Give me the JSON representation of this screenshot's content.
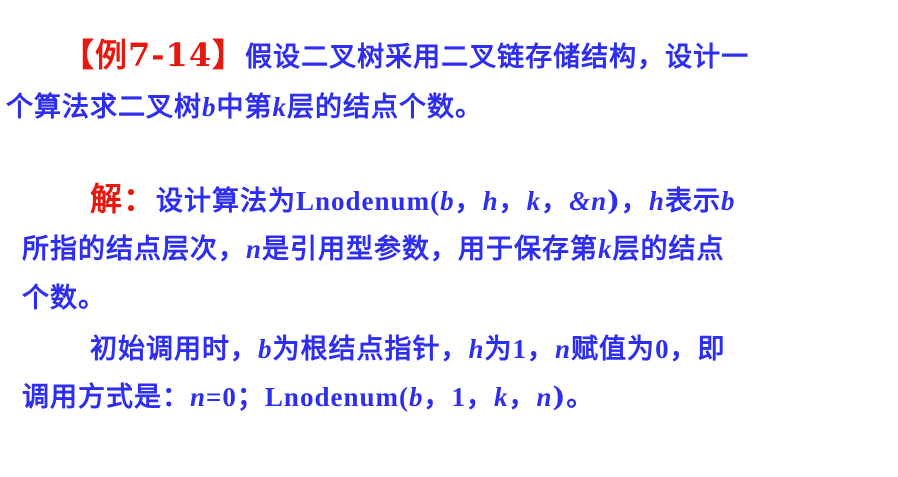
{
  "example": {
    "label": "【例7-14】",
    "line1": "假设二叉树采用二叉链存储结构，设计一",
    "line2_a": "个算法求二叉树",
    "var_b": "b",
    "line2_b": "中第",
    "var_k": "k",
    "line2_c": "层的结点个数。"
  },
  "solution": {
    "label": "解：",
    "l1_a": "设计算法为",
    "func": "Lnodenum(",
    "b": "b",
    "sep": "，",
    "h": "h",
    "k": "k",
    "amp_n": "&n",
    "close": ")，",
    "l1_b": "表示",
    "l2_a": "所指的结点层次，",
    "n": "n",
    "l2_b": "是引用型参数，用于保存第",
    "l2_c": "层的结点",
    "l3": "个数。",
    "p2_l1_a": "初始调用时，",
    "p2_l1_b": "为根结点指针，",
    "p2_l1_c": "为",
    "one": "1",
    "p2_l1_d": "，",
    "p2_l1_e": "赋值为",
    "zero": "0",
    "p2_l1_f": "，即",
    "p2_l2_a": "调用方式是：",
    "assign": "=0；",
    "func2": "Lnodenum(",
    "end": ")。"
  },
  "colors": {
    "text": "#2e2ef0",
    "accent": "#e8170f",
    "background": "#ffffff"
  }
}
